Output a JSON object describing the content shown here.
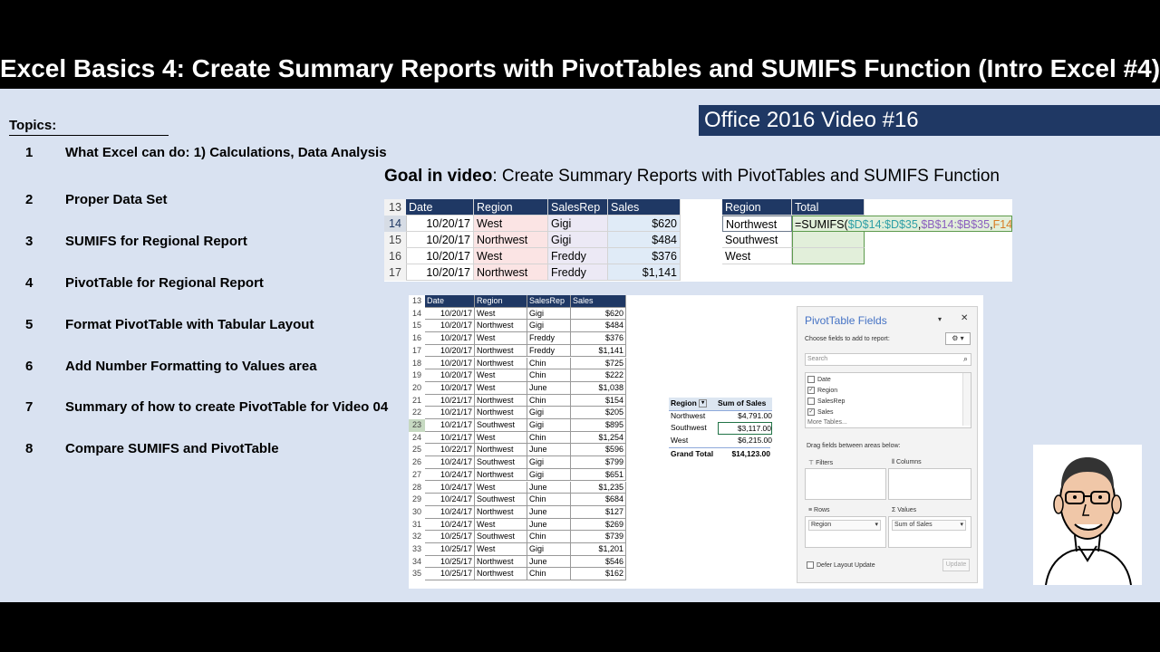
{
  "title": "Excel Basics 4: Create Summary Reports with PivotTables and SUMIFS Function (Intro Excel #4)",
  "topics_heading": "Topics:",
  "topics": [
    {
      "num": "1",
      "text": "What Excel can do: 1) Calculations, Data Analysis"
    },
    {
      "num": "2",
      "text": "Proper Data Set"
    },
    {
      "num": "3",
      "text": "SUMIFS for Regional Report"
    },
    {
      "num": "4",
      "text": "PivotTable for Regional Report"
    },
    {
      "num": "5",
      "text": "Format PivotTable with Tabular Layout"
    },
    {
      "num": "6",
      "text": "Add Number Formatting to Values area"
    },
    {
      "num": "7",
      "text": "Summary of how to create PivotTable for Video 04"
    },
    {
      "num": "8",
      "text": "Compare SUMIFS and PivotTable"
    }
  ],
  "office_badge": "Office 2016 Video #16",
  "goal_label": "Goal in video",
  "goal_text": ": Create Summary Reports with PivotTables and SUMIFS Function",
  "sheet1": {
    "row_numbers": [
      "13",
      "14",
      "15",
      "16",
      "17"
    ],
    "headers": [
      "Date",
      "Region",
      "SalesRep",
      "Sales"
    ],
    "rows": [
      [
        "10/20/17",
        "West",
        "Gigi",
        "$620"
      ],
      [
        "10/20/17",
        "Northwest",
        "Gigi",
        "$484"
      ],
      [
        "10/20/17",
        "West",
        "Freddy",
        "$376"
      ],
      [
        "10/20/17",
        "Northwest",
        "Freddy",
        "$1,141"
      ]
    ],
    "summary_headers": [
      "Region",
      "Total"
    ],
    "summary_regions": [
      "Northwest",
      "Southwest",
      "West"
    ],
    "formula": {
      "prefix": "=SUMIFS(",
      "arg1": "$D$14:$D$35",
      "sep1": ",",
      "arg2": "$B$14:$B$35",
      "sep2": ",",
      "arg3": "F14",
      "suffix": ")"
    }
  },
  "sheet2": {
    "headers": [
      "Date",
      "Region",
      "SalesRep",
      "Sales"
    ],
    "rows": [
      [
        "14",
        "10/20/17",
        "West",
        "Gigi",
        "$620"
      ],
      [
        "15",
        "10/20/17",
        "Northwest",
        "Gigi",
        "$484"
      ],
      [
        "16",
        "10/20/17",
        "West",
        "Freddy",
        "$376"
      ],
      [
        "17",
        "10/20/17",
        "Northwest",
        "Freddy",
        "$1,141"
      ],
      [
        "18",
        "10/20/17",
        "Northwest",
        "Chin",
        "$725"
      ],
      [
        "19",
        "10/20/17",
        "West",
        "Chin",
        "$222"
      ],
      [
        "20",
        "10/20/17",
        "West",
        "June",
        "$1,038"
      ],
      [
        "21",
        "10/21/17",
        "Northwest",
        "Chin",
        "$154"
      ],
      [
        "22",
        "10/21/17",
        "Northwest",
        "Gigi",
        "$205"
      ],
      [
        "23",
        "10/21/17",
        "Southwest",
        "Gigi",
        "$895"
      ],
      [
        "24",
        "10/21/17",
        "West",
        "Chin",
        "$1,254"
      ],
      [
        "25",
        "10/22/17",
        "Northwest",
        "June",
        "$596"
      ],
      [
        "26",
        "10/24/17",
        "Southwest",
        "Gigi",
        "$799"
      ],
      [
        "27",
        "10/24/17",
        "Northwest",
        "Gigi",
        "$651"
      ],
      [
        "28",
        "10/24/17",
        "West",
        "June",
        "$1,235"
      ],
      [
        "29",
        "10/24/17",
        "Southwest",
        "Chin",
        "$684"
      ],
      [
        "30",
        "10/24/17",
        "Northwest",
        "June",
        "$127"
      ],
      [
        "31",
        "10/24/17",
        "West",
        "June",
        "$269"
      ],
      [
        "32",
        "10/25/17",
        "Southwest",
        "Chin",
        "$739"
      ],
      [
        "33",
        "10/25/17",
        "West",
        "Gigi",
        "$1,201"
      ],
      [
        "34",
        "10/25/17",
        "Northwest",
        "June",
        "$546"
      ],
      [
        "35",
        "10/25/17",
        "Northwest",
        "Chin",
        "$162"
      ]
    ],
    "header_row_number": "13"
  },
  "pivot": {
    "header_region": "Region",
    "header_sum": "Sum of Sales",
    "rows": [
      [
        "Northwest",
        "$4,791.00"
      ],
      [
        "Southwest",
        "$3,117.00"
      ],
      [
        "West",
        "$6,215.00"
      ]
    ],
    "total": [
      "Grand Total",
      "$14,123.00"
    ]
  },
  "pane": {
    "title": "PivotTable Fields",
    "choose": "Choose fields to add to report:",
    "search_placeholder": "Search",
    "fields": [
      {
        "name": "Date",
        "checked": false
      },
      {
        "name": "Region",
        "checked": true
      },
      {
        "name": "SalesRep",
        "checked": false
      },
      {
        "name": "Sales",
        "checked": true
      }
    ],
    "more_tables": "More Tables...",
    "drag_text": "Drag fields between areas below:",
    "filters": "Filters",
    "columns": "Columns",
    "rows": "Rows",
    "values": "Values",
    "rows_field": "Region",
    "values_field": "Sum of Sales",
    "defer": "Defer Layout Update",
    "update": "Update"
  },
  "colors": {
    "header_navy": "#1f3864",
    "slide_bg": "#d9e2f1",
    "pane_title": "#4472c4",
    "formula_teal": "#2e9fa6",
    "formula_purple": "#8b5fbf",
    "formula_orange": "#d87c25"
  }
}
